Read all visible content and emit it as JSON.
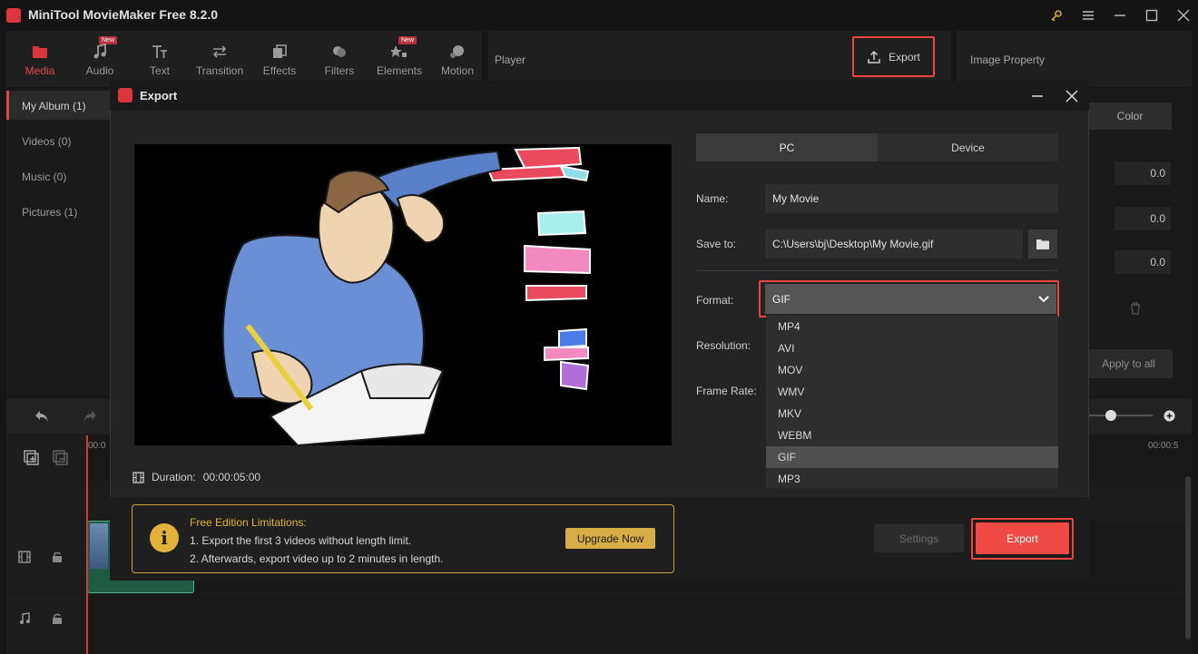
{
  "app": {
    "title": "MiniTool MovieMaker Free 8.2.0"
  },
  "toolbar": {
    "items": [
      {
        "label": "Media",
        "icon": "media-folder-icon"
      },
      {
        "label": "Audio",
        "icon": "music-note-icon",
        "badge": "New"
      },
      {
        "label": "Text",
        "icon": "text-icon"
      },
      {
        "label": "Transition",
        "icon": "transition-arrows-icon"
      },
      {
        "label": "Effects",
        "icon": "effects-icon"
      },
      {
        "label": "Filters",
        "icon": "filters-icon"
      },
      {
        "label": "Elements",
        "icon": "elements-icon",
        "badge": "New"
      },
      {
        "label": "Motion",
        "icon": "motion-icon"
      }
    ]
  },
  "player": {
    "label": "Player",
    "export_label": "Export"
  },
  "property": {
    "label": "Image Property",
    "color_tab": "Color",
    "values": [
      "0.0",
      "0.0",
      "0.0"
    ],
    "apply_all": "Apply to all"
  },
  "sidebar": {
    "items": [
      "My Album (1)",
      "Videos (0)",
      "Music (0)",
      "Pictures (1)"
    ]
  },
  "timeline": {
    "time_start": "00:0",
    "time_end": "00:00:5"
  },
  "modal": {
    "title": "Export",
    "duration_label": "Duration:",
    "duration_value": "00:00:05:00",
    "tabs": {
      "pc": "PC",
      "device": "Device"
    },
    "name_label": "Name:",
    "name_value": "My Movie",
    "save_label": "Save to:",
    "save_value": "C:\\Users\\bj\\Desktop\\My Movie.gif",
    "format_label": "Format:",
    "format_value": "GIF",
    "resolution_label": "Resolution:",
    "framerate_label": "Frame Rate:",
    "format_options": [
      "MP4",
      "AVI",
      "MOV",
      "WMV",
      "MKV",
      "WEBM",
      "GIF",
      "MP3"
    ],
    "limits": {
      "title": "Free Edition Limitations:",
      "line1": "1. Export the first 3 videos without length limit.",
      "line2": "2. Afterwards, export video up to 2 minutes in length.",
      "upgrade": "Upgrade Now"
    },
    "settings_label": "Settings",
    "export_label": "Export"
  },
  "colors": {
    "accent": "#e8463f",
    "warning": "#e2b23a",
    "bg": "#1f1f1f"
  }
}
